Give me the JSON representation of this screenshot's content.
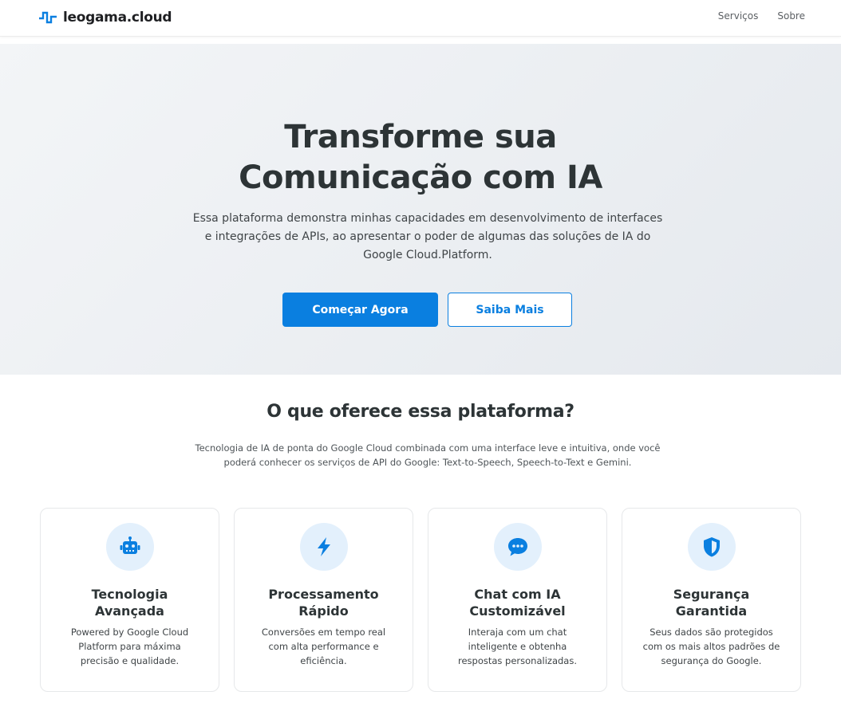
{
  "colors": {
    "accent": "#0a7fe0",
    "icon_bg": "#e3f0fc",
    "text": "#2d3436"
  },
  "navbar": {
    "brand_icon": "pulse-icon",
    "brand": "leogama.cloud",
    "links": [
      "Serviços",
      "Sobre"
    ]
  },
  "hero": {
    "title_lines": [
      "Transforme sua",
      "Comunicação com IA"
    ],
    "description_lines": [
      "Essa plataforma demonstra minhas capacidades em desenvolvimento de interfaces",
      "e integrações de APIs, ao apresentar o poder de algumas das soluções de IA do",
      "Google Cloud.Platform."
    ],
    "primary_button": "Começar Agora",
    "secondary_button": "Saiba Mais"
  },
  "features": {
    "title": "O que oferece essa plataforma?",
    "description_lines": [
      "Tecnologia de IA de ponta do Google Cloud combinada com uma interface leve e intuitiva, onde você",
      "poderá conhecer os serviços de API do Google: Text-to-Speech, Speech-to-Text e Gemini."
    ],
    "cards": [
      {
        "icon": "robot-icon",
        "title_lines": [
          "Tecnologia",
          "Avançada"
        ],
        "desc_lines": [
          "Powered by Google Cloud",
          "Platform para máxima",
          "precisão e qualidade."
        ]
      },
      {
        "icon": "lightning-bolt-icon",
        "title_lines": [
          "Processamento",
          "Rápido"
        ],
        "desc_lines": [
          "Conversões em tempo real",
          "com alta performance e",
          "eficiência."
        ]
      },
      {
        "icon": "chat-bubble-icon",
        "title_lines": [
          "Chat com IA",
          "Customizável"
        ],
        "desc_lines": [
          "Interaja com um chat",
          "inteligente e obtenha",
          "respostas personalizadas."
        ]
      },
      {
        "icon": "shield-icon",
        "title_lines": [
          "Segurança",
          "Garantida"
        ],
        "desc_lines": [
          "Seus dados são protegidos",
          "com os mais altos padrões de",
          "segurança do Google."
        ]
      }
    ]
  }
}
